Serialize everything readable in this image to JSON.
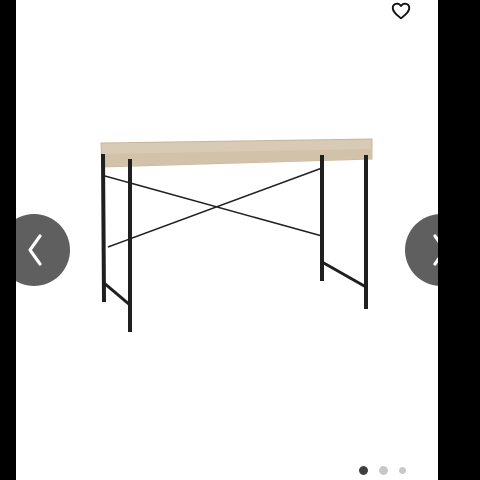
{
  "product": {
    "icon": "desk-product-photo"
  },
  "wishlist": {
    "icon": "heart-outline-icon"
  },
  "navigation": {
    "prev_icon": "chevron-left-icon",
    "next_icon": "chevron-right-icon"
  },
  "pagination": {
    "active_index": 0,
    "total": 3,
    "active_color": "#3f3f3f",
    "inactive_color": "#c8c8c8"
  },
  "colors": {
    "background": "#000000",
    "card": "#ffffff",
    "nav_button": "#5f5f5f",
    "desk_top": "#d7c8b1",
    "desk_frame": "#1f1f1f"
  }
}
